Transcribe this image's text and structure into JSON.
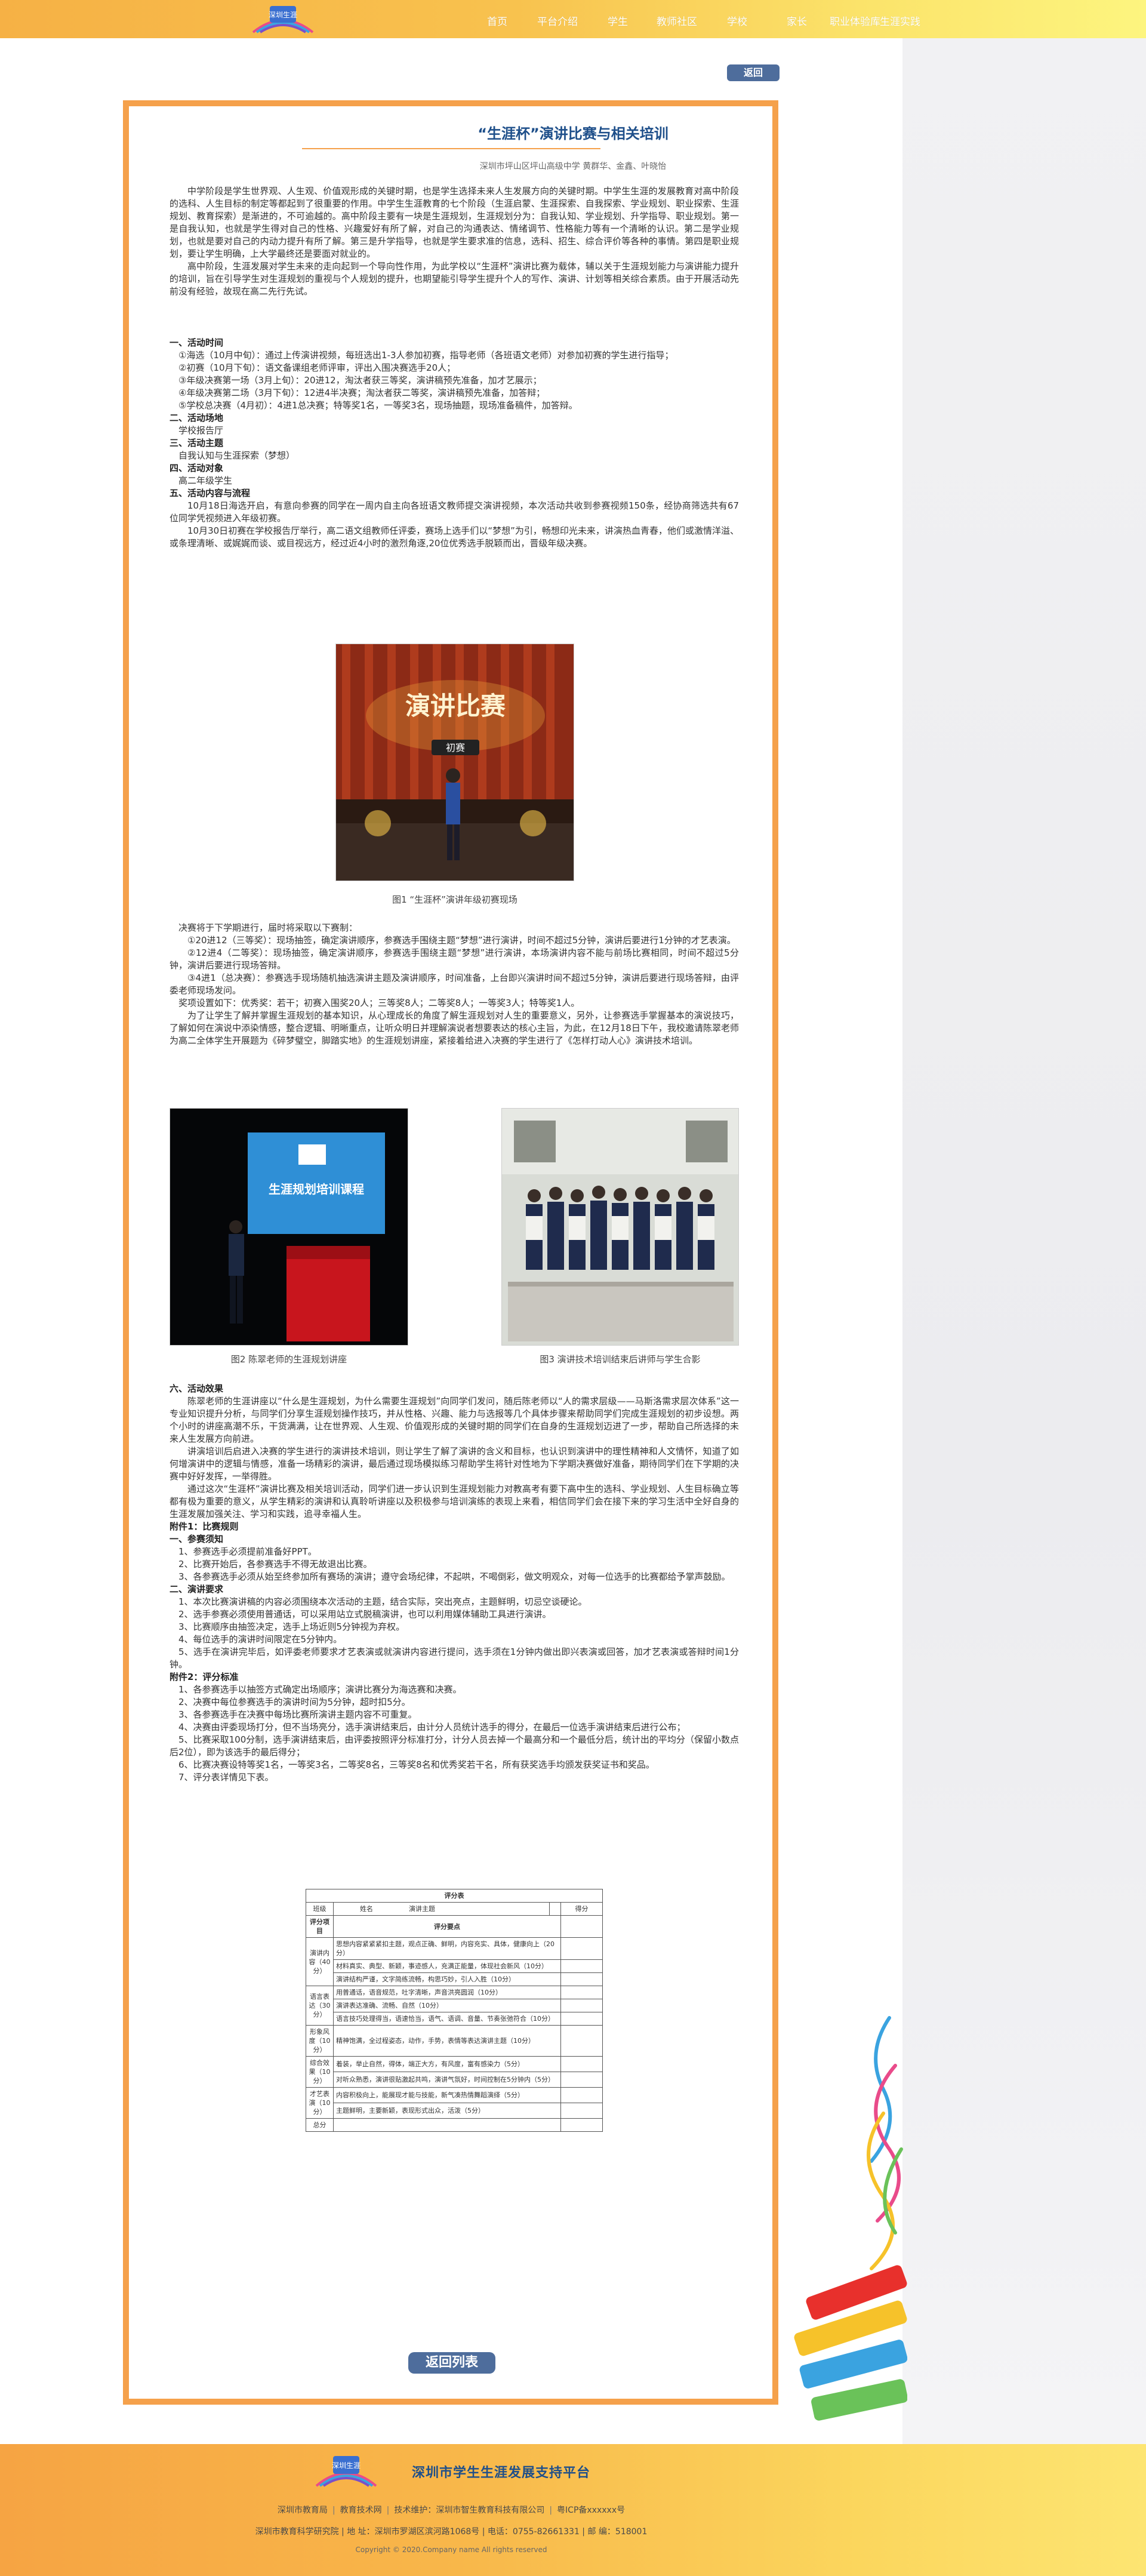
{
  "brand": {
    "logo_text": "深圳生涯",
    "logo_sub": "SHENZHEN CAREER"
  },
  "nav": [
    {
      "label": "首页"
    },
    {
      "label": "平台介绍"
    },
    {
      "label": "学生"
    },
    {
      "label": "教师社区"
    },
    {
      "label": "学校"
    },
    {
      "label": "家长"
    },
    {
      "label": "职业体验库"
    },
    {
      "label": "生涯实践"
    }
  ],
  "back_label": "返回",
  "article": {
    "title": "“生涯杯”演讲比赛与相关培训",
    "byline": "深圳市坪山区坪山高级中学  黄群华、金鑫、叶晓怡",
    "intro": [
      "中学阶段是学生世界观、人生观、价值观形成的关键时期，也是学生选择未来人生发展方向的关键时期。中学生生涯的发展教育对高中阶段的选科、人生目标的制定等都起到了很重要的作用。中学生生涯教育的七个阶段（生涯启蒙、生涯探索、自我探索、学业规划、职业探索、生涯规划、教育探索）是渐进的，不可逾越的。高中阶段主要有一块是生涯规划，生涯规划分为：自我认知、学业规划、升学指导、职业规划。第一是自我认知，也就是学生得对自己的性格、兴趣爱好有所了解，对自己的沟通表达、情绪调节、性格能力等有一个清晰的认识。第二是学业规划，也就是要对自己的内动力提升有所了解。第三是升学指导，也就是学生要求准的信息，选科、招生、综合评价等各种的事情。第四是职业规划，要让学生明确，上大学最终还是要面对就业的。",
      "高中阶段，生涯发展对学生未来的走向起到一个导向性作用，为此学校以“生涯杯”演讲比赛为载体，辅以关于生涯规划能力与演讲能力提升的培训，旨在引导学生对生涯规划的重视与个人规划的提升，也期望能引导学生提升个人的写作、演讲、计划等相关综合素质。由于开展活动先前没有经验，故现在高二先行先试。"
    ],
    "sections_a": [
      {
        "kind": "h",
        "text": "一、活动时间"
      },
      {
        "kind": "p",
        "text": "①海选（10月中旬）：通过上传演讲视频，每班选出1-3人参加初赛，指导老师（各班语文老师）对参加初赛的学生进行指导；"
      },
      {
        "kind": "p",
        "text": "②初赛（10月下旬）：语文备课组老师评审，评出入围决赛选手20人；"
      },
      {
        "kind": "p",
        "text": "③年级决赛第一场（3月上旬）：20进12，淘汰者获三等奖，演讲稿预先准备，加才艺展示；"
      },
      {
        "kind": "p",
        "text": "④年级决赛第二场（3月下旬）：12进4半决赛；淘汰者获二等奖，演讲稿预先准备，加答辩；"
      },
      {
        "kind": "p",
        "text": "⑤学校总决赛（4月初）：4进1总决赛；特等奖1名，一等奖3名，现场抽题，现场准备稿件，加答辩。"
      },
      {
        "kind": "h",
        "text": "二、活动场地"
      },
      {
        "kind": "p",
        "text": "学校报告厅"
      },
      {
        "kind": "h",
        "text": "三、活动主题"
      },
      {
        "kind": "p",
        "text": "自我认知与生涯探索（梦想）"
      },
      {
        "kind": "h",
        "text": "四、活动对象"
      },
      {
        "kind": "p",
        "text": "高二年级学生"
      },
      {
        "kind": "h",
        "text": "五、活动内容与流程"
      },
      {
        "kind": "i",
        "text": "10月18日海选开启，有意向参赛的同学在一周内自主向各班语文教师提交演讲视频，本次活动共收到参赛视频150条，经协商筛选共有67位同学凭视频进入年级初赛。"
      },
      {
        "kind": "i",
        "text": "10月30日初赛在学校报告厅举行，高二语文组教师任评委，赛场上选手们以“梦想”为引，畅想印光未来，讲演热血青春，他们或激情洋溢、或条理清晰、或娓娓而谈、或目视远方，经过近4小时的激烈角逐,20位优秀选手脱颖而出，晋级年级决赛。"
      }
    ],
    "fig1_caption": "图1  “生涯杯”演讲年级初赛现场",
    "fig1_sign_text": "演讲比赛",
    "fig1_sign_sub": "初赛",
    "sections_b": [
      {
        "kind": "p",
        "text": "决赛将于下学期进行，届时将采取以下赛制："
      },
      {
        "kind": "i",
        "text": "①20进12（三等奖）：现场抽签，确定演讲顺序，参赛选手围绕主题“梦想”进行演讲，时间不超过5分钟，演讲后要进行1分钟的才艺表演。"
      },
      {
        "kind": "i",
        "text": "②12进4（二等奖）：现场抽签，确定演讲顺序，参赛选手围绕主题“梦想”进行演讲，本场演讲内容不能与前场比赛相同，时间不超过5分钟，演讲后要进行现场答辩。"
      },
      {
        "kind": "i",
        "text": "③4进1（总决赛）：参赛选手现场随机抽选演讲主题及演讲顺序，时间准备，上台即兴演讲时间不超过5分钟，演讲后要进行现场答辩，由评委老师现场发问。"
      },
      {
        "kind": "p",
        "text": "奖项设置如下：优秀奖：若干；初赛入围奖20人；三等奖8人；二等奖8人；一等奖3人；特等奖1人。"
      },
      {
        "kind": "i",
        "text": "为了让学生了解并掌握生涯规划的基本知识，从心理成长的角度了解生涯规划对人生的重要意义，另外，让参赛选手掌握基本的演说技巧，了解如何在演说中添染情感，整合逻辑、明晰重点，让听众明日并理解演说者想要表达的核心主旨，为此，在12月18日下午，我校邀请陈翠老师为高二全体学生开展题为《碎梦璧空，脚踏实地》的生涯规划讲座，紧接着给进入决赛的学生进行了《怎样打动人心》演讲技术培训。"
      }
    ],
    "fig2_caption": "图2  陈翠老师的生涯规划讲座",
    "fig2_screen_title": "生涯规划培训课程",
    "fig3_caption": "图3  演讲技术培训结束后讲师与学生合影",
    "sections_c": [
      {
        "kind": "h",
        "text": "六、活动效果"
      },
      {
        "kind": "i",
        "text": "陈翠老师的生涯讲座以“什么是生涯规划，为什么需要生涯规划”向同学们发问，随后陈老师以“人的需求层级——马斯洛需求层次体系”这一专业知识提升分析，与同学们分享生涯规划操作技巧，并从性格、兴趣、能力与选报等几个具体步骤来帮助同学们完成生涯规划的初步设想。两个小时的讲座高潮不乐，干货满满，让在世界观、人生观、价值观形成的关键时期的同学们在自身的生涯规划迈进了一步，帮助自己所选择的未来人生发展方向前进。"
      },
      {
        "kind": "i",
        "text": "讲演培训后启进入决赛的学生进行的演讲技术培训，则让学生了解了演讲的含义和目标，也认识到演讲中的理性精神和人文情怀，知道了如何增演讲中的逻辑与情感，准备一场精彩的演讲，最后通过现场模拟练习帮助学生将针对性地为下学期决赛做好准备，期待同学们在下学期的决赛中好好发挥，一举得胜。"
      },
      {
        "kind": "i",
        "text": "通过这次“生涯杯”演讲比赛及相关培训活动，同学们进一步认识到生涯规划能力对教高考有要下高中生的选科、学业规划、人生目标确立等都有极为重要的意义，从学生精彩的演讲和认真聆听讲座以及积极参与培训演练的表现上来看，相信同学们会在接下来的学习生活中全好自身的生涯发展加强关注、学习和实践，追寻幸福人生。"
      },
      {
        "kind": "h",
        "text": "附件1：比赛规则"
      },
      {
        "kind": "h",
        "text": "一、参赛须知"
      },
      {
        "kind": "p",
        "text": "1、参赛选手必须提前准备好PPT。"
      },
      {
        "kind": "p",
        "text": "2、比赛开始后，各参赛选手不得无故退出比赛。"
      },
      {
        "kind": "p",
        "text": "3、各参赛选手必须从始至终参加所有赛场的演讲；遵守会场纪律，不起哄，不喝倒彩，做文明观众，对每一位选手的比赛都给予掌声鼓励。"
      },
      {
        "kind": "h",
        "text": "二、演讲要求"
      },
      {
        "kind": "p",
        "text": "1、本次比赛演讲稿的内容必须围绕本次活动的主题，结合实际，突出亮点，主题鲜明，切忌空谈硬论。"
      },
      {
        "kind": "p",
        "text": "2、选手参赛必须使用普通话，可以采用站立式脱稿演讲，也可以利用媒体辅助工具进行演讲。"
      },
      {
        "kind": "p",
        "text": "3、比赛顺序由抽签决定，选手上场近则5分钟视为弃权。"
      },
      {
        "kind": "p",
        "text": "4、每位选手的演讲时间限定在5分钟内。"
      },
      {
        "kind": "p",
        "text": "5、选手在演讲完毕后，如评委老师要求才艺表演或就演讲内容进行提问，选手须在1分钟内做出即兴表演或回答，加才艺表演或答辩时间1分钟。"
      },
      {
        "kind": "h",
        "text": "附件2：评分标准"
      },
      {
        "kind": "p",
        "text": "1、各参赛选手以抽签方式确定出场顺序；演讲比赛分为海选赛和决赛。"
      },
      {
        "kind": "p",
        "text": "2、决赛中每位参赛选手的演讲时间为5分钟，超时扣5分。"
      },
      {
        "kind": "p",
        "text": "3、各参赛选手在决赛中每场比赛所演讲主题内容不可重复。"
      },
      {
        "kind": "p",
        "text": "4、决赛由评委现场打分，但不当场亮分，选手演讲结束后，由计分人员统计选手的得分，在最后一位选手演讲结束后进行公布；"
      },
      {
        "kind": "p",
        "text": "5、比赛采取100分制，选手演讲结束后，由评委按照评分标准打分，计分人员去掉一个最高分和一个最低分后，统计出的平均分（保留小数点后2位），即为该选手的最后得分；"
      },
      {
        "kind": "p",
        "text": "6、比赛决赛设特等奖1名，一等奖3名，二等奖8名，三等奖8名和优秀奖若干名，所有获奖选手均颁发获奖证书和奖品。"
      },
      {
        "kind": "p",
        "text": "7、评分表详情见下表。"
      }
    ],
    "score_table": {
      "title": "评分表",
      "head": {
        "class_label": "班级",
        "name_label": "姓名",
        "topic_label": "演讲主题",
        "score_label": "得分"
      },
      "col1": "评分项目",
      "col2": "评分要点",
      "groups": [
        {
          "name": "演讲内容（40分）",
          "items": [
            "思想内容紧紧紧扣主题，观点正确、鲜明，内容充实、具体，健康向上（20分）",
            "材料真实、典型、新颖，事迹感人，充满正能量，体现社会新风（10分）",
            "演讲结构严谨，文字简练流畅，构思巧妙，引人入胜（10分）"
          ]
        },
        {
          "name": "语言表达（30分）",
          "items": [
            "用普通话，语音规范，吐字清晰，声音洪亮圆润（10分）",
            "演讲表达准确、流畅、自然（10分）",
            "语言技巧处理得当，语速恰当，语气、语调、音量、节奏张弛符合（10分）"
          ]
        },
        {
          "name": "形象风度（10分）",
          "items": [
            "精神饱满，全过程姿态，动作，手势，表情等表达演讲主题（10分）"
          ]
        },
        {
          "name": "综合效果（10分）",
          "items": [
            "着装，举止自然，得体，端正大方，有风度，富有感染力（5分）",
            "对听众熟悉，演讲很贴激起共鸣，演讲气氛好，时间控制在5分钟内（5分）"
          ]
        },
        {
          "name": "才艺表演（10分）",
          "items": [
            "内容积极向上，能展现才能与技能，新气凑热情舞蹈演绎（5分）",
            "主题鲜明，主要新颖，表现形式出众，活泼（5分）"
          ]
        }
      ],
      "total_label": "总分"
    },
    "back_list_label": "返回列表"
  },
  "footer": {
    "org_name": "深圳市学生生涯发展支持平台",
    "links": [
      "深圳市教育局",
      "教育技术网",
      "技术维护：深圳市智生教育科技有限公司",
      "粤ICP备xxxxxx号"
    ],
    "address": "深圳市教育科学研究院  |  地 址：深圳市罗湖区滨河路1068号  |  电话：0755-82661331  |  邮 编：518001",
    "copyright": "Copyright © 2020.Company name All rights reserved"
  },
  "colors": {
    "orange": "#f5a14b",
    "accent_blue": "#4e6d9c",
    "title_blue": "#1e4f8a"
  }
}
